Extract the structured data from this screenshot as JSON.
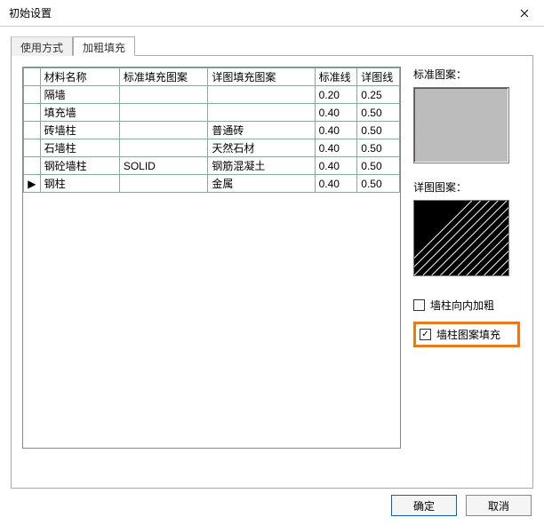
{
  "window": {
    "title": "初始设置"
  },
  "tabs": [
    {
      "label": "使用方式",
      "active": false
    },
    {
      "label": "加粗填充",
      "active": true
    }
  ],
  "table": {
    "columns": [
      "材料名称",
      "标准填充图案",
      "详图填充图案",
      "标准线",
      "详图线"
    ],
    "rows": [
      {
        "marker": "",
        "name": "隔墙",
        "std_pattern": "",
        "detail_pattern": "",
        "std_w": "0.20",
        "det_w": "0.25"
      },
      {
        "marker": "",
        "name": "填充墙",
        "std_pattern": "",
        "detail_pattern": "",
        "std_w": "0.40",
        "det_w": "0.50"
      },
      {
        "marker": "",
        "name": "砖墙柱",
        "std_pattern": "",
        "detail_pattern": "普通砖",
        "std_w": "0.40",
        "det_w": "0.50"
      },
      {
        "marker": "",
        "name": "石墙柱",
        "std_pattern": "",
        "detail_pattern": "天然石材",
        "std_w": "0.40",
        "det_w": "0.50"
      },
      {
        "marker": "",
        "name": "钢砼墙柱",
        "std_pattern": "SOLID",
        "detail_pattern": "钢筋混凝土",
        "std_w": "0.40",
        "det_w": "0.50"
      },
      {
        "marker": "▶",
        "name": "钢柱",
        "std_pattern": "",
        "detail_pattern": "金属",
        "std_w": "0.40",
        "det_w": "0.50"
      }
    ]
  },
  "side": {
    "std_label": "标准图案：",
    "detail_label": "详图图案：",
    "chk_bold": {
      "label": "墙柱向内加粗",
      "checked": false
    },
    "chk_fill": {
      "label": "墙柱图案填充",
      "checked": true
    }
  },
  "buttons": {
    "ok": "确定",
    "cancel": "取消"
  }
}
